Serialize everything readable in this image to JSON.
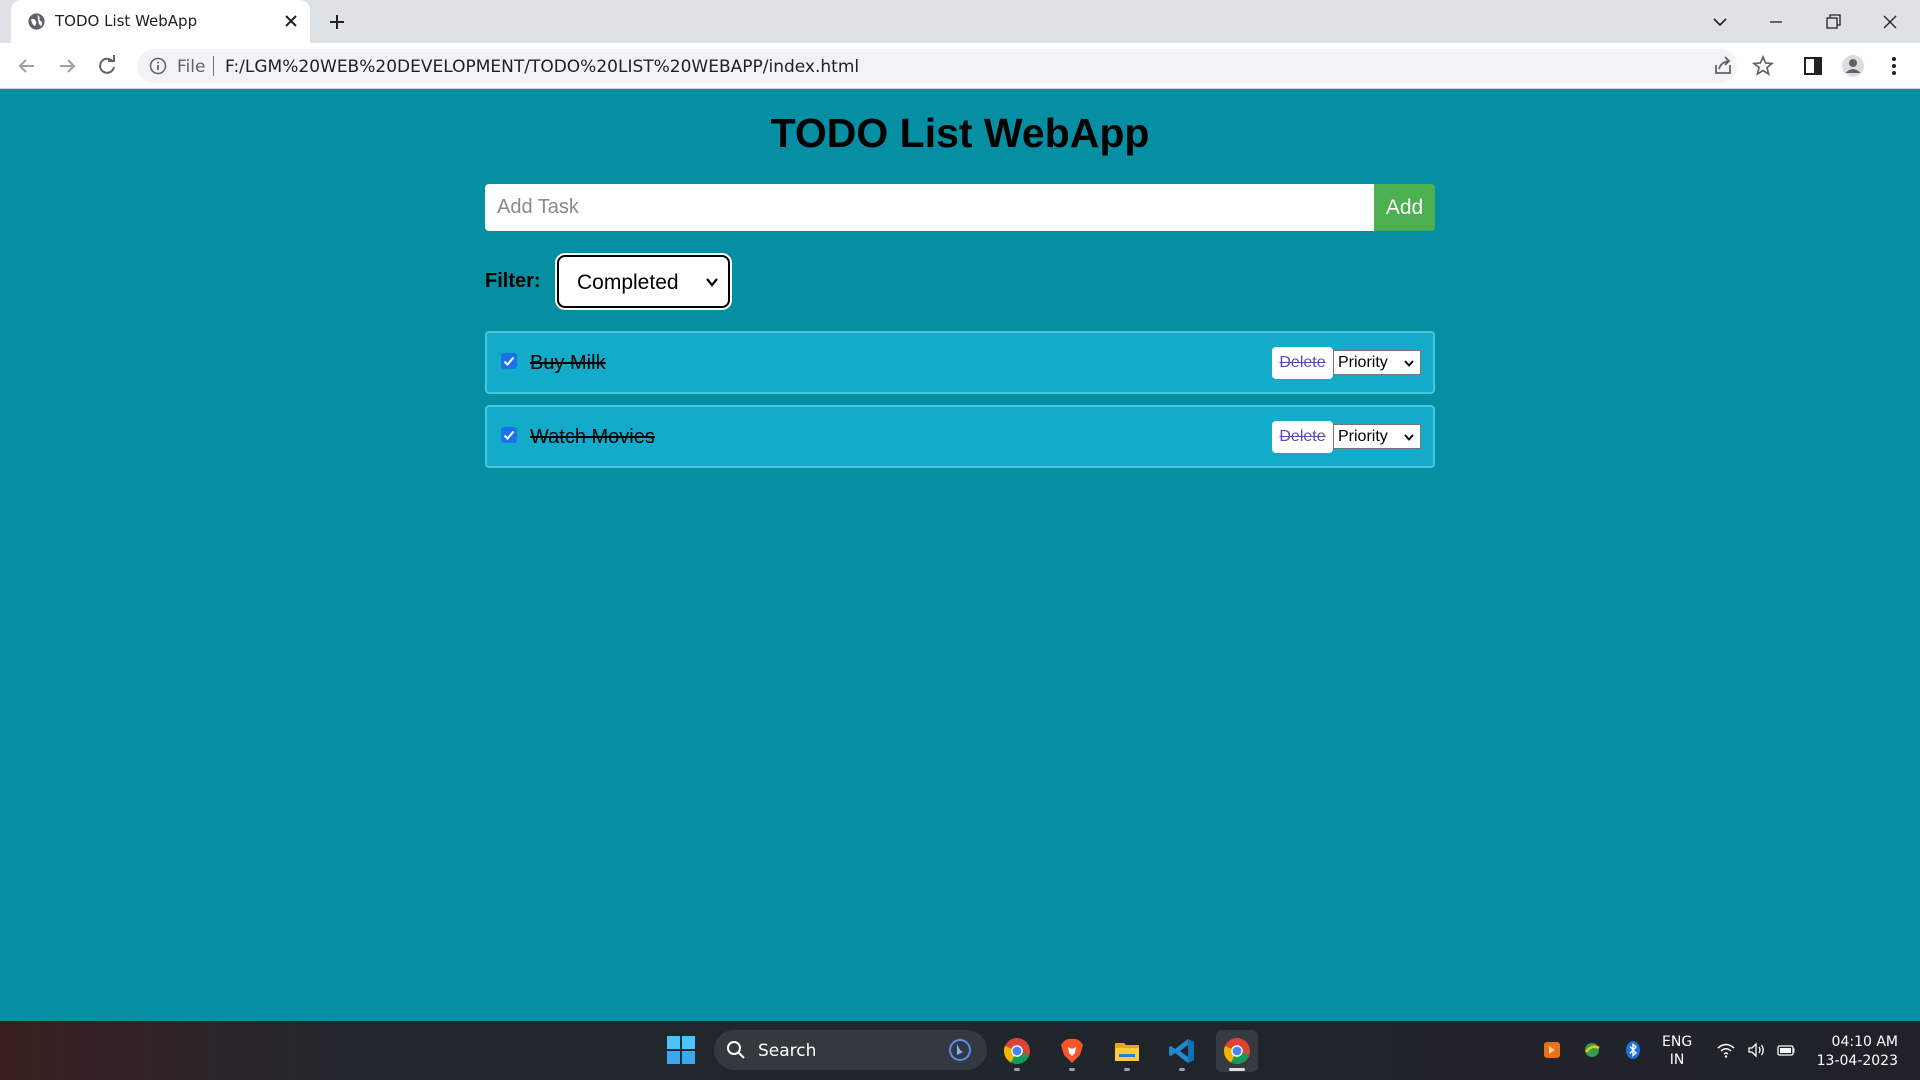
{
  "browser": {
    "tab_title": "TODO List WebApp",
    "url_scheme_label": "File",
    "url": "F:/LGM%20WEB%20DEVELOPMENT/TODO%20LIST%20WEBAPP/index.html"
  },
  "app": {
    "title": "TODO List WebApp",
    "input_placeholder": "Add Task",
    "add_label": "Add",
    "filter_label": "Filter:",
    "filter_value": "Completed",
    "tasks": [
      {
        "text": "Buy Milk",
        "completed": true,
        "delete_label": "Delete",
        "priority_label": "Priority"
      },
      {
        "text": "Watch Movies",
        "completed": true,
        "delete_label": "Delete",
        "priority_label": "Priority"
      }
    ]
  },
  "taskbar": {
    "search_label": "Search",
    "lang_line1": "ENG",
    "lang_line2": "IN",
    "time": "04:10 AM",
    "date": "13-04-2023",
    "apps": [
      "chrome-icon",
      "brave-icon",
      "file-explorer-icon",
      "vscode-icon",
      "chrome-icon"
    ]
  },
  "colors": {
    "page_background": "#068FA3",
    "task_background": "#14ABCA",
    "add_button": "#4CAF50",
    "checkbox": "#1A73E8"
  }
}
